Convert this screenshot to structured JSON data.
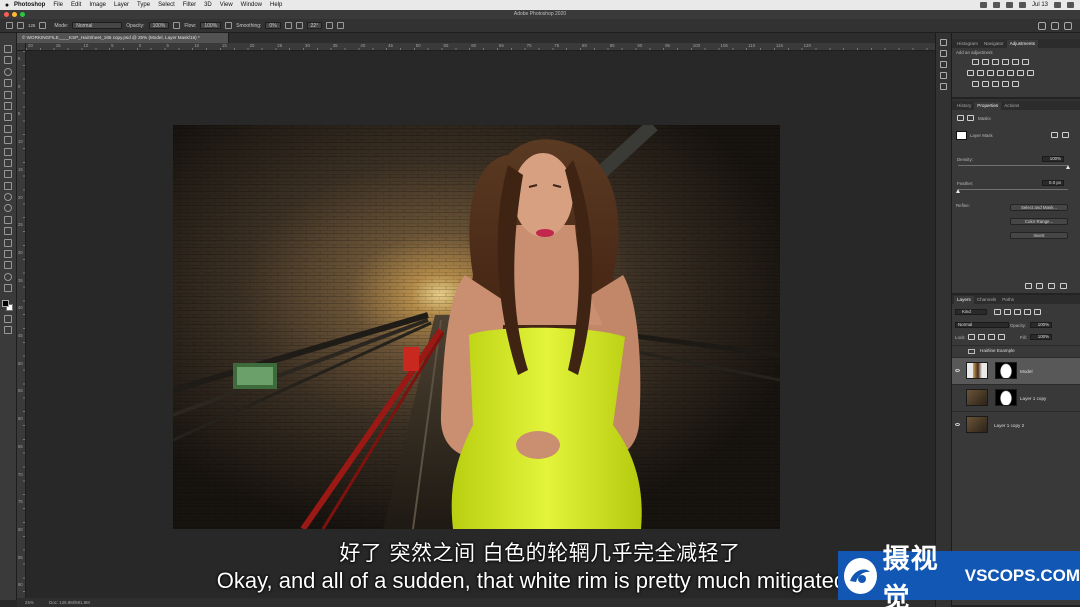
{
  "menubar": {
    "app_name": "Photoshop",
    "items": [
      "File",
      "Edit",
      "Image",
      "Layer",
      "Type",
      "Select",
      "Filter",
      "3D",
      "View",
      "Window",
      "Help"
    ],
    "clock": "Jul 13"
  },
  "window": {
    "title": "Adobe Photoshop 2020"
  },
  "options_bar": {
    "brush_size": "125",
    "mode_label": "Mode:",
    "mode_value": "Normal",
    "opacity_label": "Opacity:",
    "opacity_value": "100%",
    "flow_label": "Flow:",
    "flow_value": "100%",
    "smoothing_label": "Smoothing:",
    "smoothing_value": "0%",
    "angle_value": "22°"
  },
  "document": {
    "tab_title": "© WORKINGFILE____KSP_HairSheet_165 copy.psd @ 25% (Model, Layer Mask/16) *",
    "zoom": "25%",
    "doc_info": "Doc: 126.8M/591.9M"
  },
  "ruler": {
    "top_ticks": [
      "20",
      "15",
      "10",
      "5",
      "0",
      "5",
      "10",
      "15",
      "20",
      "25",
      "30",
      "35",
      "40",
      "45",
      "50",
      "55",
      "60",
      "65",
      "70",
      "75",
      "80",
      "85",
      "90",
      "95",
      "100",
      "105",
      "110",
      "115",
      "120"
    ],
    "left_ticks": [
      "5",
      "0",
      "5",
      "10",
      "15",
      "20",
      "25",
      "30",
      "35",
      "40",
      "45",
      "50",
      "55",
      "60",
      "65",
      "70",
      "75",
      "80",
      "85",
      "90"
    ]
  },
  "panels": {
    "top_tabs": [
      "Histogram",
      "Navigator",
      "Adjustments"
    ],
    "adjustments_hint": "Add an adjustment",
    "props_tabs": [
      "History",
      "Properties",
      "Actions"
    ],
    "props_title": "Masks",
    "props_mask_label": "Layer Mask",
    "density_label": "Density:",
    "density_value": "100%",
    "density": 1.0,
    "feather_label": "Feather:",
    "feather_value": "0.0 px",
    "feather": 0.0,
    "refine_label": "Refine:",
    "btn_select_mask": "Select and Mask...",
    "btn_color_range": "Color Range...",
    "btn_invert": "Invert",
    "layers_tabs": [
      "Layers",
      "Channels",
      "Paths"
    ],
    "kind_label": "Kind",
    "blend_mode": "Normal",
    "opacity_label": "Opacity:",
    "opacity_value": "100%",
    "lock_label": "Lock:",
    "fill_label": "Fill:",
    "fill_value": "100%",
    "layers": [
      {
        "name": "Hairline Example",
        "visible": false,
        "type": "group"
      },
      {
        "name": "Model",
        "visible": true,
        "type": "masked",
        "selected": true
      },
      {
        "name": "Layer 1 copy",
        "visible": false,
        "type": "masked"
      },
      {
        "name": "Layer 1 copy 2",
        "visible": true,
        "type": "plain"
      }
    ]
  },
  "subtitles": {
    "chinese": "好了 突然之间 白色的轮辋几乎完全减轻了",
    "english": "Okay, and all of a sudden, that white rim is pretty much mitigated c"
  },
  "watermark": {
    "cn": "摄视觉",
    "en": "VSCOPS.COM"
  },
  "colors": {
    "dress": "#d6ea1c",
    "hair": "#4a2a17",
    "watermark_bg": "#1257b3"
  }
}
